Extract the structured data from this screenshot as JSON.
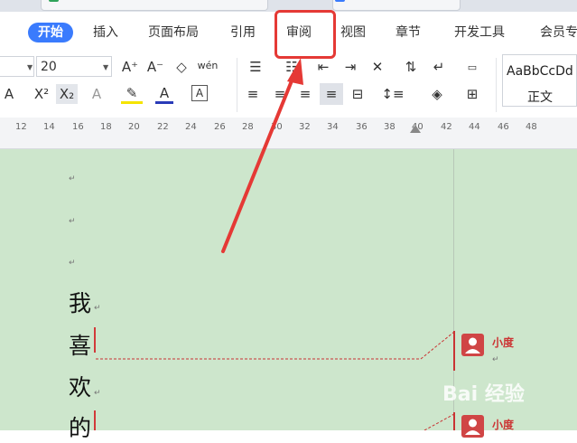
{
  "tabs": [
    {
      "id": "start",
      "label": "开始"
    },
    {
      "id": "insert",
      "label": "插入"
    },
    {
      "id": "layout",
      "label": "页面布局"
    },
    {
      "id": "reference",
      "label": "引用"
    },
    {
      "id": "review",
      "label": "审阅"
    },
    {
      "id": "view",
      "label": "视图"
    },
    {
      "id": "chapter",
      "label": "章节"
    },
    {
      "id": "developer",
      "label": "开发工具"
    },
    {
      "id": "member",
      "label": "会员专"
    }
  ],
  "ribbon": {
    "font_size": "20",
    "phonetic_glyph": "wén",
    "style_sample": "AaBbCcDd",
    "style_name": "正文"
  },
  "ruler": [
    "12",
    "14",
    "16",
    "18",
    "20",
    "22",
    "24",
    "26",
    "28",
    "30",
    "32",
    "34",
    "36",
    "38",
    "40",
    "42",
    "44",
    "46",
    "48"
  ],
  "document": {
    "paragraph_mark": "↵",
    "chars": [
      "我",
      "喜",
      "欢",
      "的"
    ]
  },
  "comments": [
    {
      "author": "小度"
    },
    {
      "author": "小度"
    }
  ],
  "watermark": "Bai 经验",
  "colors": {
    "accent": "#3a7bfd",
    "annotation_red": "#e53935",
    "doc_bg": "#cde6cc"
  }
}
